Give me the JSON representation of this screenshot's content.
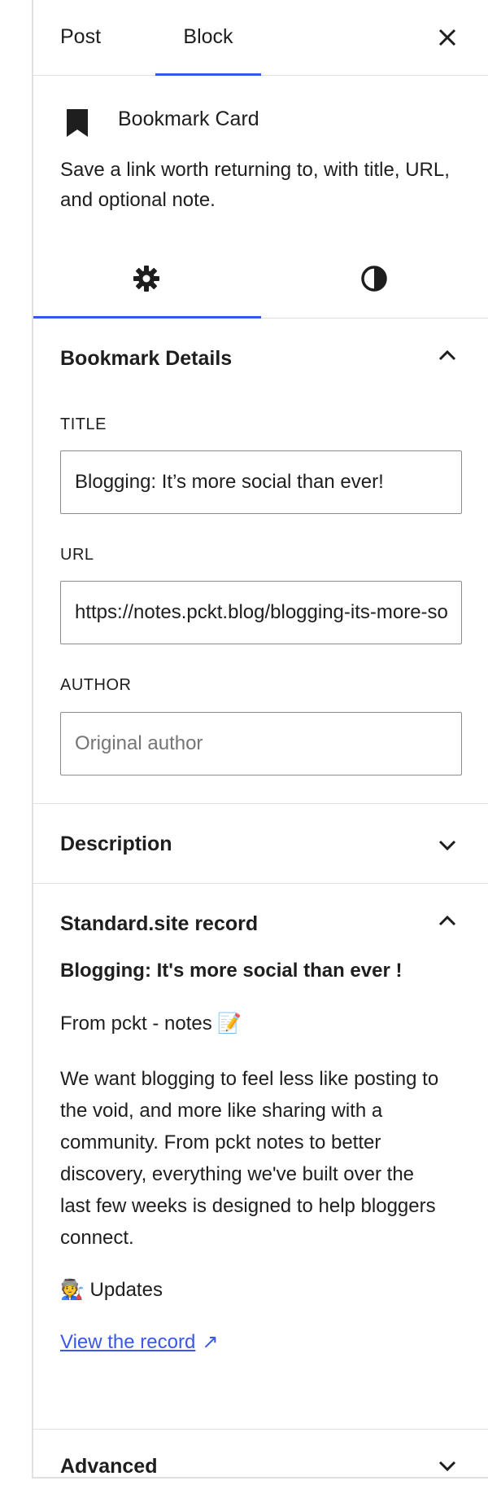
{
  "tabs": {
    "post": "Post",
    "block": "Block"
  },
  "block": {
    "icon": "bookmark-icon",
    "title": "Bookmark Card",
    "description": "Save a link worth returning to, with title, URL, and optional note."
  },
  "subtabs": {
    "settings_icon": "gear-icon",
    "styles_icon": "contrast-icon"
  },
  "details": {
    "title": "Bookmark Details",
    "fields": {
      "title_label": "TITLE",
      "title_value": "Blogging: It’s more social than ever!",
      "url_label": "URL",
      "url_value": "https://notes.pckt.blog/blogging-its-more-social-than-ever",
      "author_label": "AUTHOR",
      "author_placeholder": "Original author"
    }
  },
  "description_panel": {
    "title": "Description"
  },
  "record": {
    "panel_title": "Standard.site record",
    "title": "Blogging: It's more social than ever !",
    "source": "From pckt - notes 📝",
    "body": "We want blogging to feel less like posting to the void, and more like sharing with a community. From pckt notes to better discovery, everything we've built over the last few weeks is designed to help bloggers connect.",
    "tag": "🧑‍🏭 Updates",
    "link_text": "View the record",
    "link_arrow": "↗"
  },
  "advanced_panel": {
    "title": "Advanced"
  },
  "colors": {
    "accent": "#3858e9",
    "border": "#e0e0e0",
    "text": "#1e1e1e"
  }
}
